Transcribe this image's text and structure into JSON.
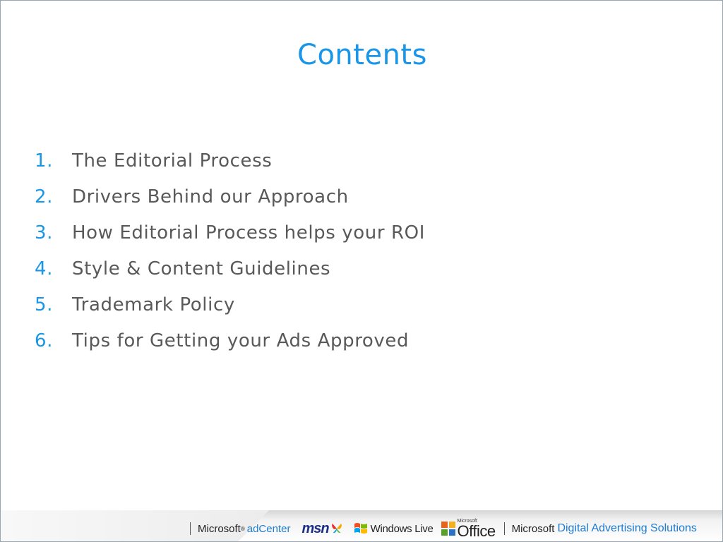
{
  "slide": {
    "title": "Contents",
    "items": [
      {
        "num": "1.",
        "text": "The Editorial Process"
      },
      {
        "num": "2.",
        "text": "Drivers Behind our Approach"
      },
      {
        "num": "3.",
        "text": "How Editorial Process helps your ROI"
      },
      {
        "num": "4.",
        "text": "Style & Content Guidelines"
      },
      {
        "num": "5.",
        "text": "Trademark Policy"
      },
      {
        "num": "6.",
        "text": "Tips for Getting your Ads Approved"
      }
    ]
  },
  "footer": {
    "microsoft": "Microsoft",
    "reg": "®",
    "adcenter": "adCenter",
    "msn": "msn",
    "windows_live": "Windows Live",
    "office_small": "Microsoft",
    "office": "Office",
    "microsoft2": "Microsoft",
    "das": "Digital Advertising Solutions"
  },
  "colors": {
    "accent": "#1a96e8",
    "body_text": "#595959",
    "brand_blue": "#1e7bd0"
  }
}
